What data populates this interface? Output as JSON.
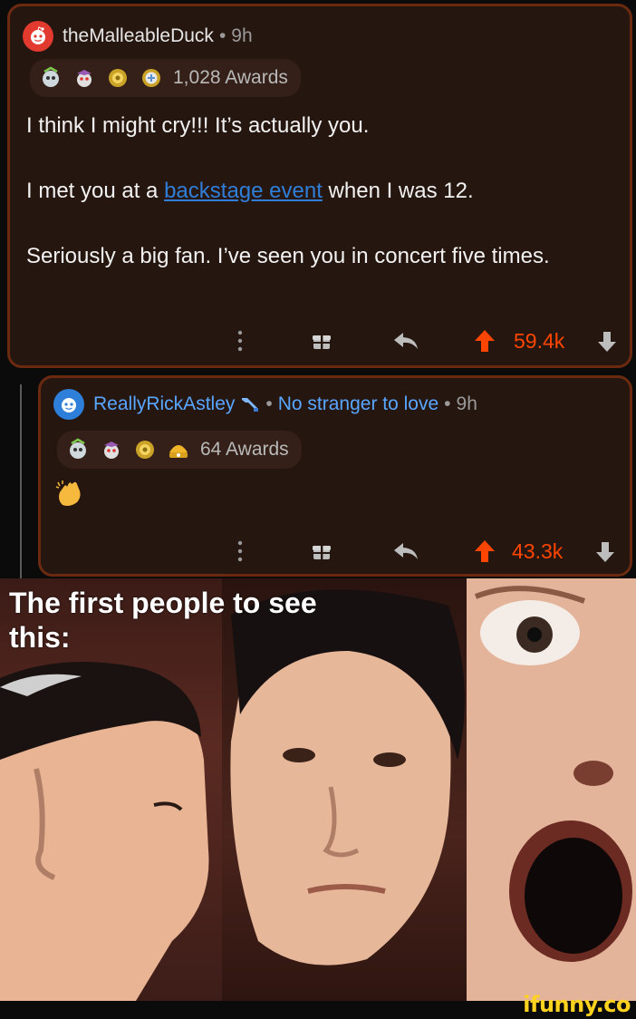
{
  "comment1": {
    "username": "theMalleableDuck",
    "time": "9h",
    "awards_label": "1,028 Awards",
    "line1": "I think I might cry!!! It’s actually you.",
    "line2_pre": "I met you at a ",
    "line2_link": "backstage event",
    "line2_post": " when I was 12.",
    "line3": "Seriously a big fan. I’ve seen you in concert five times.",
    "score": "59.4k"
  },
  "comment2": {
    "username": "ReallyRickAstley",
    "flair": "No stranger to love",
    "time": "9h",
    "awards_label": "64 Awards",
    "body_emoji": "clapping-hands",
    "score": "43.3k"
  },
  "meme": {
    "caption": "The first people to see this:"
  },
  "watermark": "ifunny.co",
  "colors": {
    "comment_bg": "#261610",
    "comment_border": "#6b2a10",
    "upvote": "#ff4500",
    "link": "#2f7fd8",
    "flair": "#58a6ff",
    "watermark": "#ffd21f"
  },
  "icons": [
    "reddit-avatar-icon",
    "award-icon",
    "more-dots-icon",
    "gift-icon",
    "reply-icon",
    "upvote-icon",
    "downvote-icon",
    "wrench-icon",
    "clap-icon"
  ]
}
